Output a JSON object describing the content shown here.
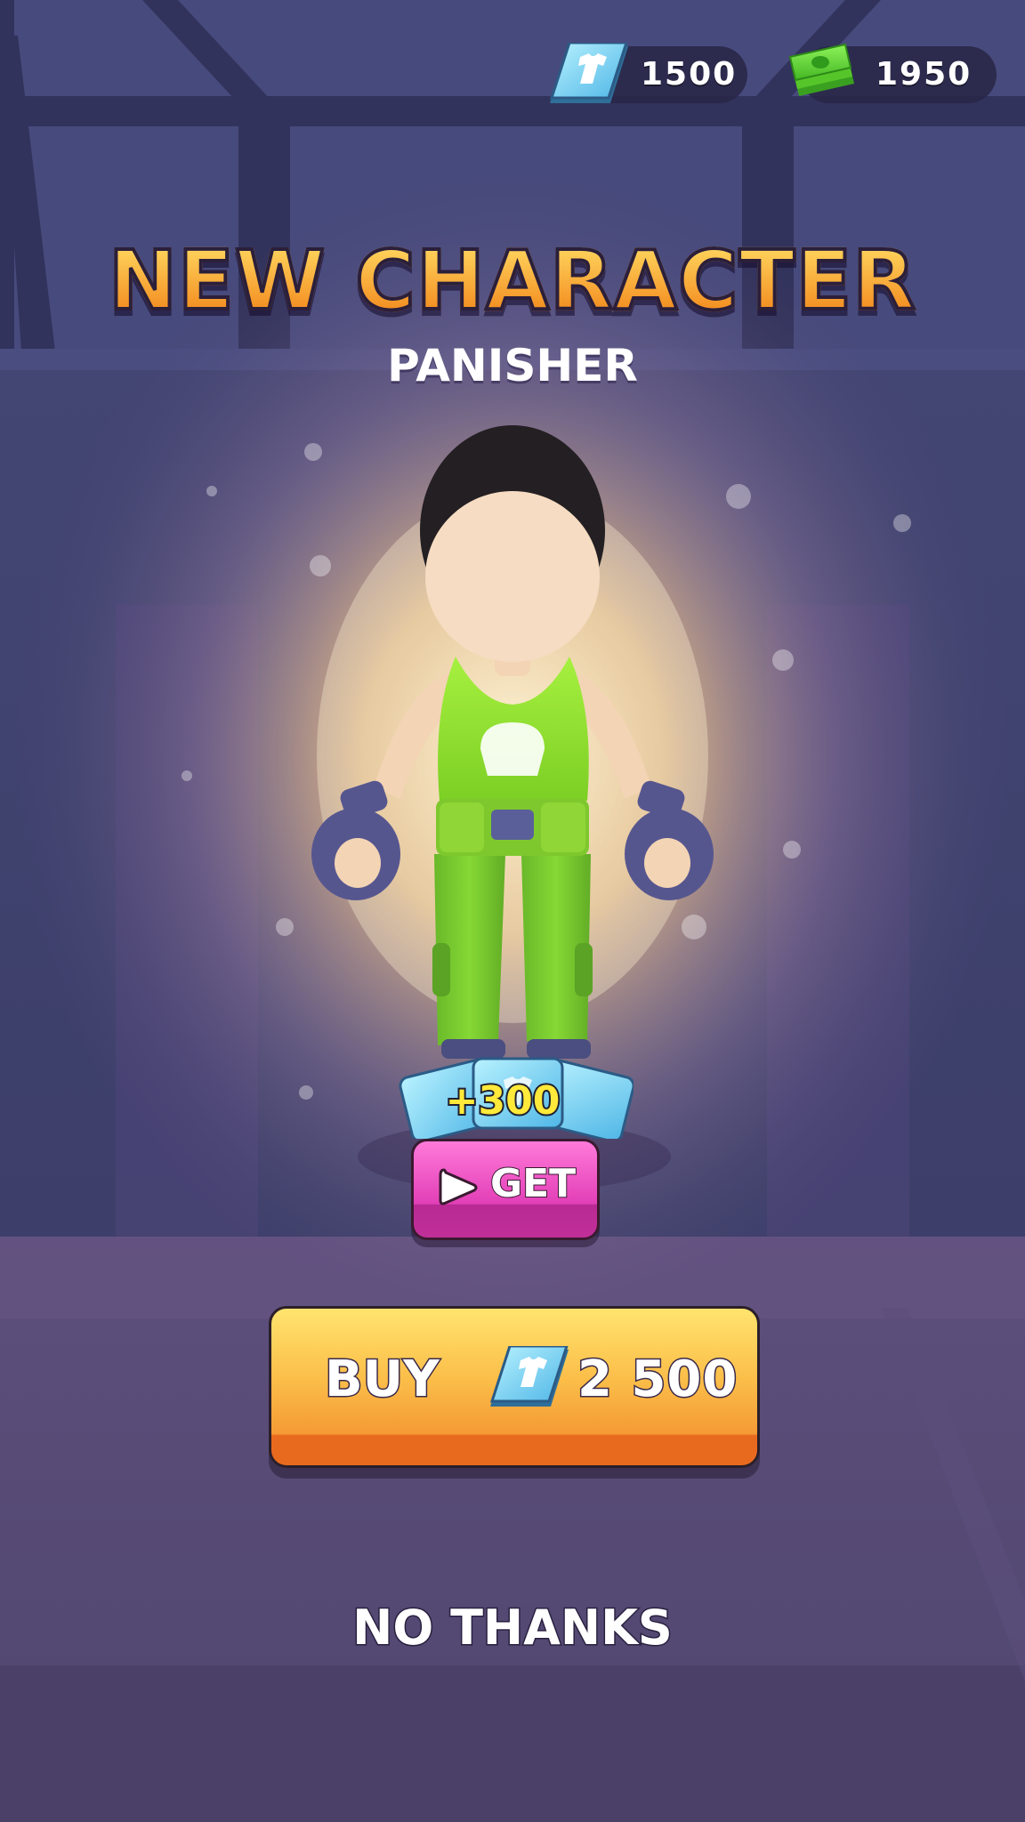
{
  "hud": {
    "gems": {
      "icon": "shirt-ticket-icon",
      "value": "1500"
    },
    "cash": {
      "icon": "cash-stack-icon",
      "value": "1950"
    }
  },
  "title": "NEW CHARACTER",
  "character_name": "PANISHER",
  "reward": {
    "bonus": "+300",
    "get_label": "GET",
    "get_icon": "play-icon",
    "card_icon": "shirt-ticket-icon"
  },
  "buy": {
    "label": "BUY",
    "icon": "shirt-ticket-icon",
    "price": "2 500"
  },
  "no_thanks_label": "NO THANKS",
  "colors": {
    "title_gradient_top": "#ffd35c",
    "title_gradient_bottom": "#f28a1e",
    "get_button": "#e23fb7",
    "buy_button": "#f9b244",
    "tank_top": "#8ee02e",
    "pants": "#6fc12c",
    "gloves": "#56568f",
    "background": "#4a4468"
  }
}
